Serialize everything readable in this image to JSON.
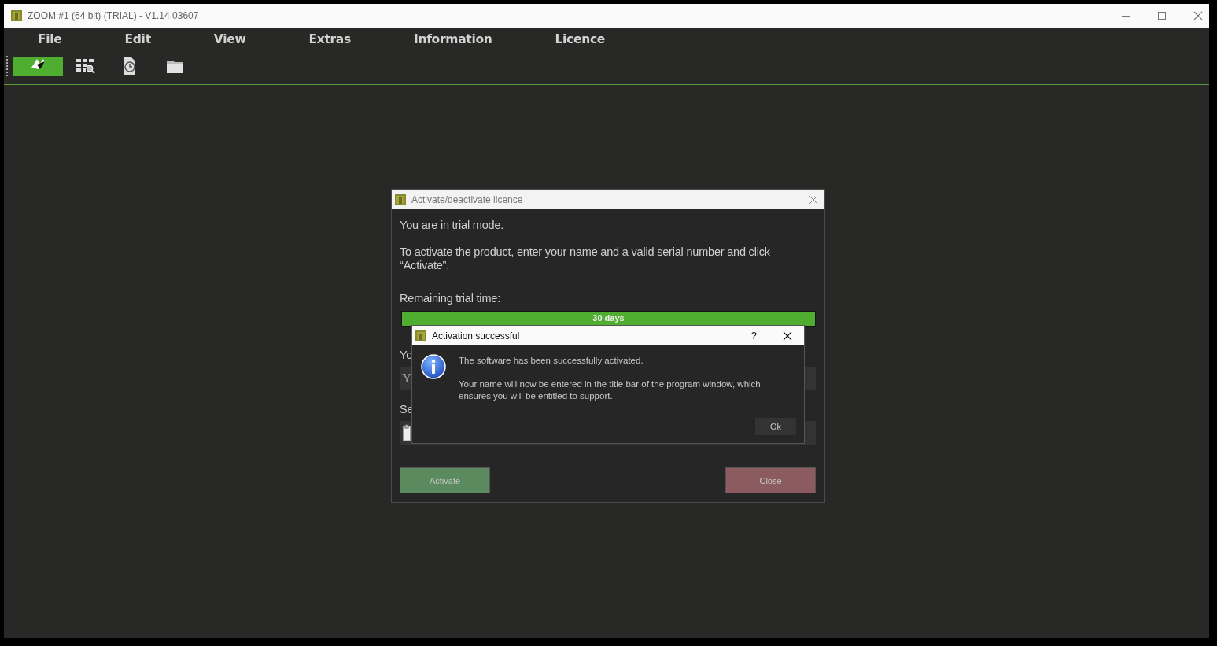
{
  "window": {
    "title": "ZOOM #1 (64 bit) (TRIAL) - V1.14.03607"
  },
  "menu": [
    {
      "label": "File"
    },
    {
      "label": "Edit"
    },
    {
      "label": "View"
    },
    {
      "label": "Extras"
    },
    {
      "label": "Information"
    },
    {
      "label": "Licence"
    }
  ],
  "toolbar": [
    {
      "kind": "logo",
      "selected": true
    },
    {
      "kind": "grid-search",
      "selected": false
    },
    {
      "kind": "history",
      "selected": false
    },
    {
      "kind": "folder",
      "selected": false
    }
  ],
  "licence_dialog": {
    "title": "Activate/deactivate licence",
    "intro": "You are in trial mode.",
    "instruction": "To activate the product, enter your name and a valid serial number and click “Activate”.",
    "trial_label": "Remaining trial time:",
    "trial_progress": {
      "level": 1,
      "reading": "30 days"
    },
    "name_label": "Yo",
    "name_field": {
      "value": "Y"
    },
    "serial_label": "Se",
    "buttons": [
      {
        "label": "Activate",
        "kind": "primary"
      },
      {
        "label": "Close",
        "kind": "cancel"
      }
    ]
  },
  "message_box": {
    "title": "Activation successful",
    "help": "?",
    "message": "The software has been successfully activated.",
    "detail": "Your name will now be entered in the title bar of the program window, which ensures you will be entitled to support.",
    "buttons": [
      {
        "label": "Ok"
      }
    ]
  }
}
